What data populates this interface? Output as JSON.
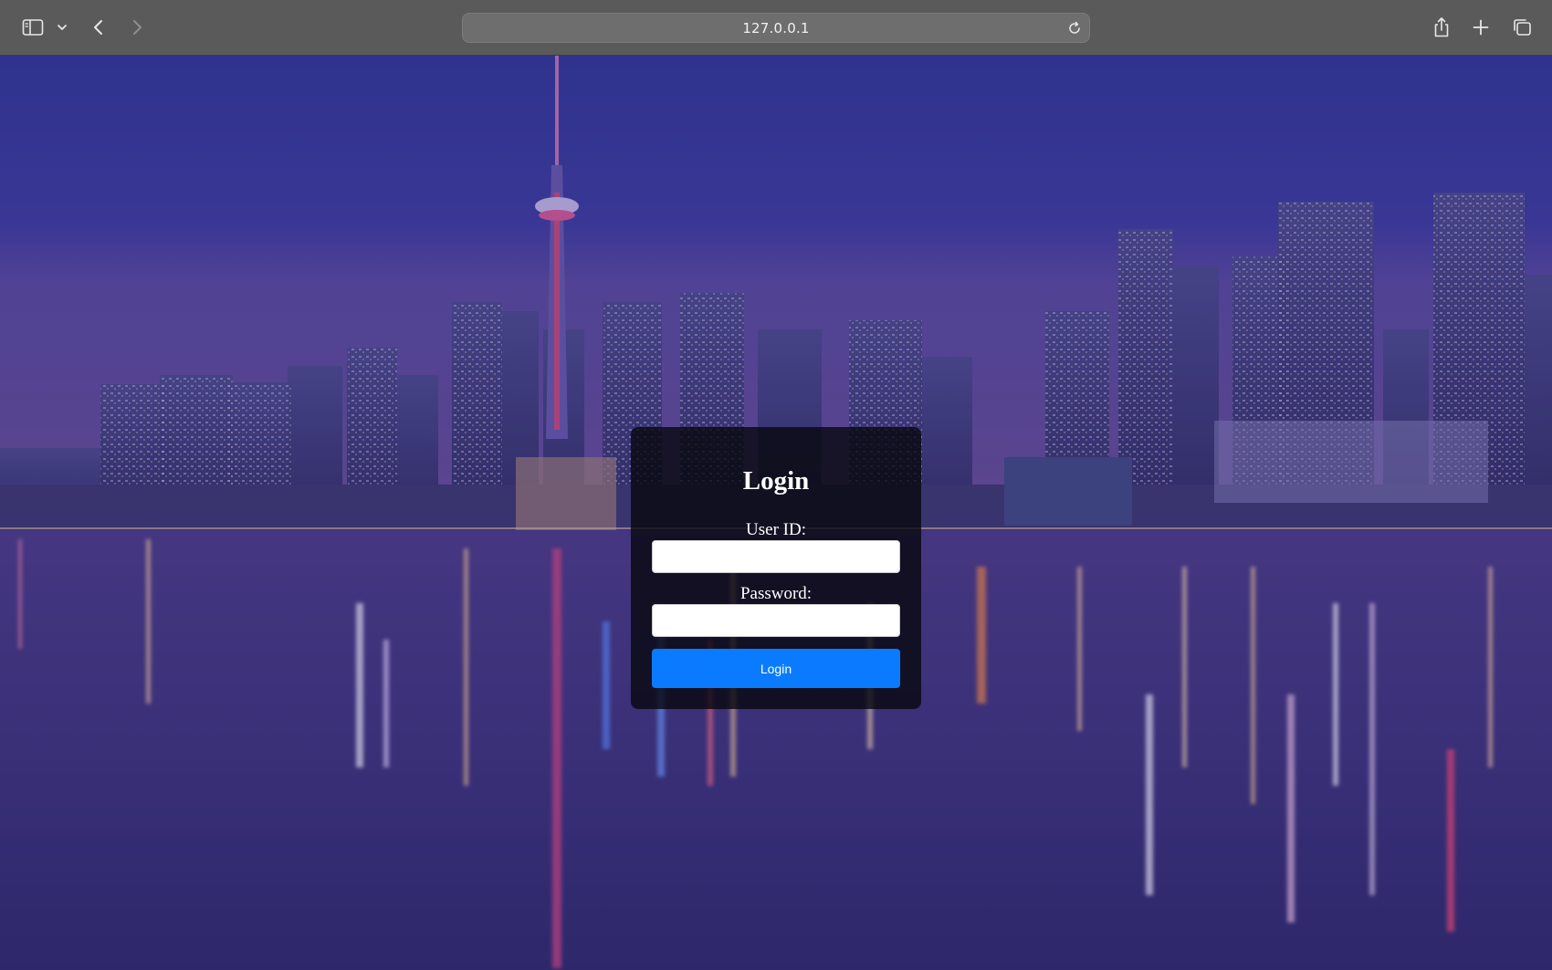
{
  "browser": {
    "url": "127.0.0.1",
    "icons": {
      "sidebar": "sidebar-icon",
      "dropdown": "chevron-down-icon",
      "back": "chevron-left-icon",
      "forward": "chevron-right-icon",
      "reload": "reload-icon",
      "share": "share-icon",
      "new_tab": "plus-icon",
      "tabs": "tabs-overview-icon"
    }
  },
  "login": {
    "title": "Login",
    "user_id_label": "User ID:",
    "user_id_value": "",
    "password_label": "Password:",
    "password_value": "",
    "button_label": "Login"
  },
  "colors": {
    "toolbar": "#5a5a5a",
    "button": "#0a7bff",
    "card": "#08080e"
  }
}
